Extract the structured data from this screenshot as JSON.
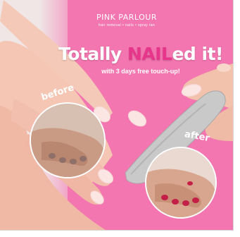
{
  "brand": {
    "name": "PINK PARLOUR",
    "tagline": "hair removal • nails • spray tan"
  },
  "headline": {
    "prefix": "Totally ",
    "highlight": "NAIL",
    "suffix": "ed it!"
  },
  "subline": "with 3 days free touch-up!",
  "before_label": "before",
  "after_label": "after",
  "colors": {
    "background_pink": "#f476b0",
    "highlight_pink": "#e8358c",
    "text": "#ffffff"
  }
}
